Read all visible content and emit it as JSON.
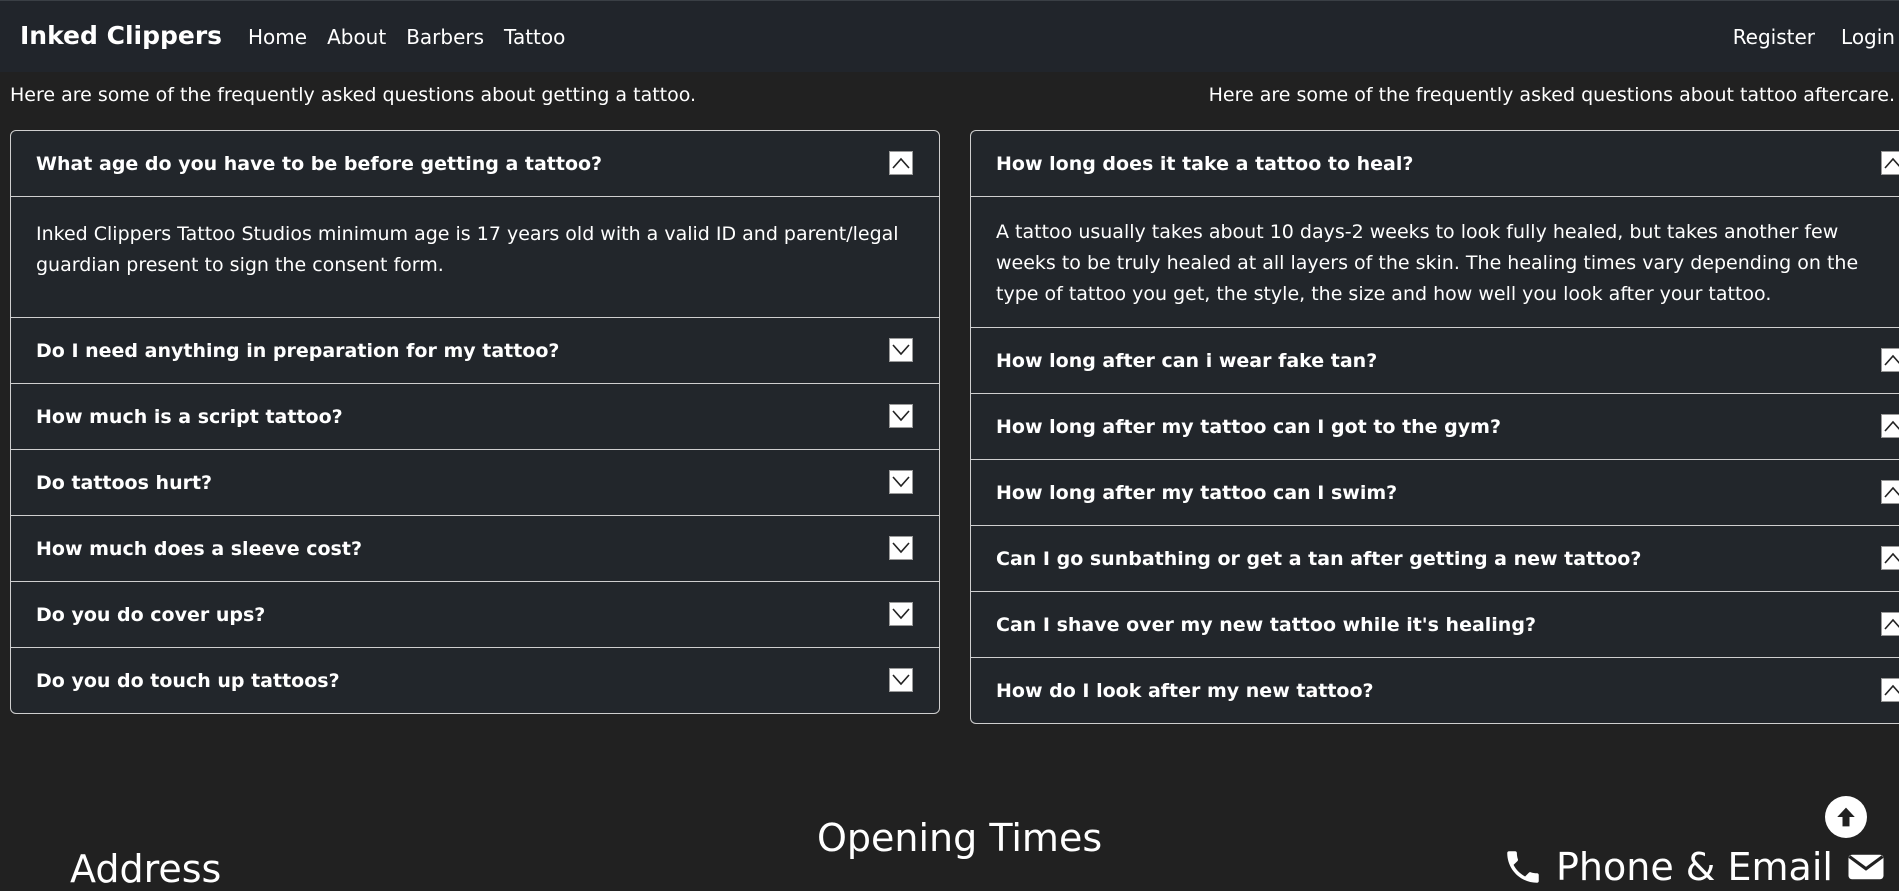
{
  "nav": {
    "brand": "Inked Clippers",
    "left": [
      "Home",
      "About",
      "Barbers",
      "Tattoo"
    ],
    "right": [
      "Register",
      "Login"
    ]
  },
  "faq_left": {
    "intro": "Here are some of the frequently asked questions about getting a tattoo.",
    "items": [
      {
        "question": "What age do you have to be before getting a tattoo?",
        "answer": "Inked Clippers Tattoo Studios minimum age is 17 years old with a valid ID and parent/legal guardian present to sign the consent form.",
        "expanded": true
      },
      {
        "question": "Do I need anything in preparation for my tattoo?",
        "expanded": false
      },
      {
        "question": "How much is a script tattoo?",
        "expanded": false
      },
      {
        "question": "Do tattoos hurt?",
        "expanded": false
      },
      {
        "question": "How much does a sleeve cost?",
        "expanded": false
      },
      {
        "question": "Do you do cover ups?",
        "expanded": false
      },
      {
        "question": "Do you do touch up tattoos?",
        "expanded": false
      }
    ]
  },
  "faq_right": {
    "intro": "Here are some of the frequently asked questions about tattoo aftercare.",
    "items": [
      {
        "question": "How long does it take a tattoo to heal?",
        "answer": "A tattoo usually takes about 10 days-2 weeks to look fully healed, but takes another few weeks to be truly healed at all layers of the skin. The healing times vary depending on the type of tattoo you get, the style, the size and how well you look after your tattoo.",
        "expanded": true
      },
      {
        "question": "How long after can i wear fake tan?",
        "expanded": false
      },
      {
        "question": "How long after my tattoo can I got to the gym?",
        "expanded": false
      },
      {
        "question": "How long after my tattoo can I swim?",
        "expanded": false
      },
      {
        "question": "Can I go sunbathing or get a tan after getting a new tattoo?",
        "expanded": false
      },
      {
        "question": "Can I shave over my new tattoo while it's healing?",
        "expanded": false
      },
      {
        "question": "How do I look after my new tattoo?",
        "expanded": false
      }
    ]
  },
  "footer": {
    "address_title": "Address",
    "opening_title": "Opening Times",
    "contact_title": "Phone & Email"
  },
  "icons": {
    "chevron_up": "chevron-up-icon",
    "chevron_down": "chevron-down-icon",
    "phone": "phone-icon",
    "envelope": "envelope-icon",
    "back_to_top": "arrow-up-circle-icon"
  }
}
